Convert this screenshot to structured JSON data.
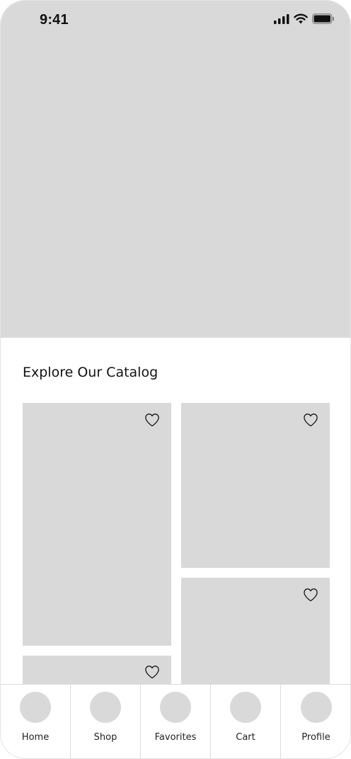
{
  "status_bar": {
    "time": "9:41",
    "icons": [
      "cellular-signal-icon",
      "wifi-icon",
      "battery-icon"
    ]
  },
  "hero": {
    "color": "#d9d9d9"
  },
  "catalog": {
    "title": "Explore Our Catalog",
    "cards": [
      {
        "name": "catalog-card-1",
        "icon": "heart-icon"
      },
      {
        "name": "catalog-card-2",
        "icon": "heart-icon"
      },
      {
        "name": "catalog-card-3",
        "icon": "heart-icon"
      },
      {
        "name": "catalog-card-4",
        "icon": "heart-icon"
      }
    ]
  },
  "tab_bar": {
    "tabs": [
      {
        "label": "Home"
      },
      {
        "label": "Shop"
      },
      {
        "label": "Favorites"
      },
      {
        "label": "Cart"
      },
      {
        "label": "Profile"
      }
    ]
  },
  "colors": {
    "placeholder": "#d9d9d9",
    "background": "#ffffff",
    "text": "#111111",
    "divider": "#dcdcdc"
  }
}
